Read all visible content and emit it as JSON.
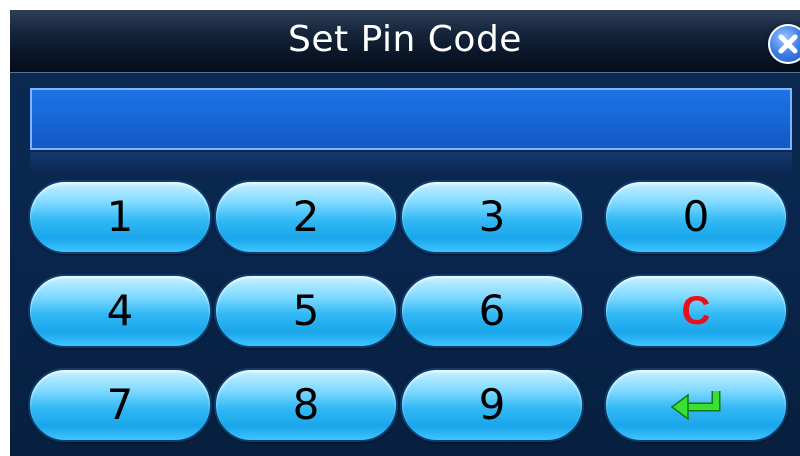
{
  "dialog": {
    "title": "Set Pin Code",
    "close_icon": "close-icon"
  },
  "pin_field": {
    "value": ""
  },
  "keypad": {
    "keys": [
      {
        "label": "1"
      },
      {
        "label": "2"
      },
      {
        "label": "3"
      },
      {
        "label": "0"
      },
      {
        "label": "4"
      },
      {
        "label": "5"
      },
      {
        "label": "6"
      },
      {
        "label": "C"
      },
      {
        "label": "7"
      },
      {
        "label": "8"
      },
      {
        "label": "9"
      },
      {
        "label": "",
        "icon": "enter-arrow-icon"
      }
    ]
  },
  "colors": {
    "background": "#0a2750",
    "display": "#1866d6",
    "key": "#31b8f5",
    "clear_text": "#e8101a",
    "enter_icon": "#2fd12a"
  }
}
